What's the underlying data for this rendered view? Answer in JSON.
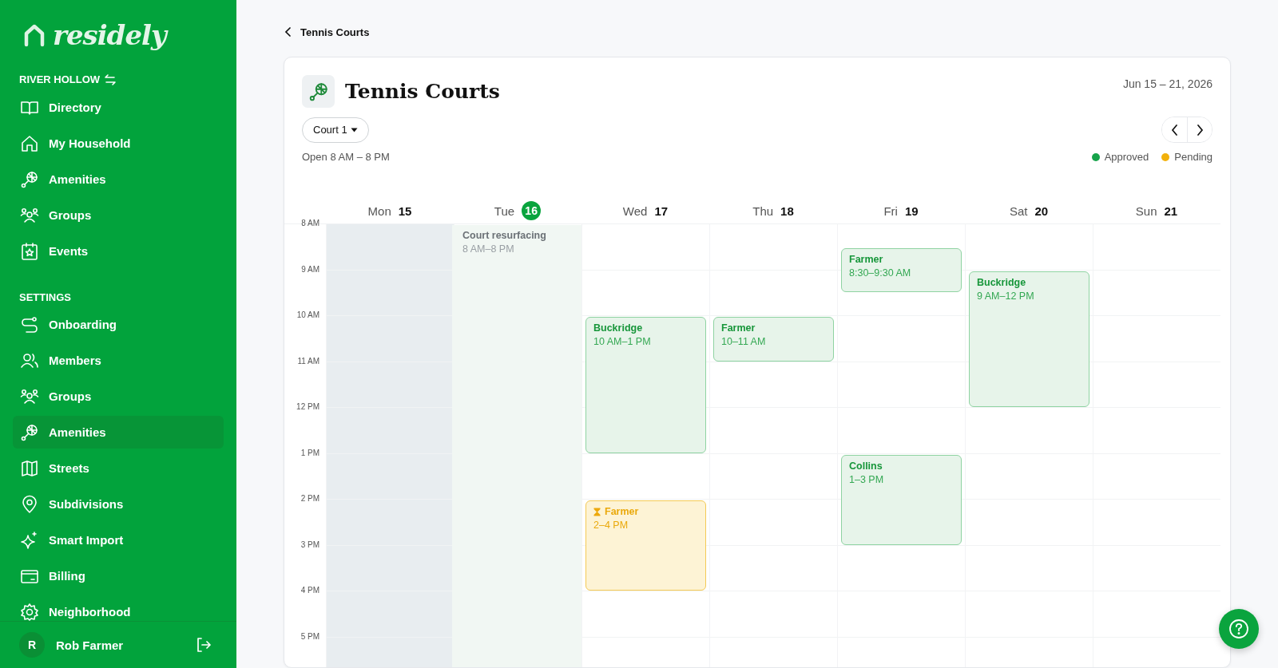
{
  "sidebar": {
    "logo": "residely",
    "community": "RIVER HOLLOW",
    "main_items": [
      {
        "label": "Directory",
        "selected": false
      },
      {
        "label": "My Household",
        "selected": false
      },
      {
        "label": "Amenities",
        "selected": false
      },
      {
        "label": "Groups",
        "selected": false
      },
      {
        "label": "Events",
        "selected": false
      }
    ],
    "settings_heading": "SETTINGS",
    "settings_items": [
      {
        "label": "Onboarding",
        "selected": false
      },
      {
        "label": "Members",
        "selected": false
      },
      {
        "label": "Groups",
        "selected": false
      },
      {
        "label": "Amenities",
        "selected": true
      },
      {
        "label": "Streets",
        "selected": false
      },
      {
        "label": "Subdivisions",
        "selected": false
      },
      {
        "label": "Smart Import",
        "selected": false
      },
      {
        "label": "Billing",
        "selected": false
      },
      {
        "label": "Neighborhood",
        "selected": false
      }
    ],
    "user": {
      "initial": "R",
      "name": "Rob Farmer"
    }
  },
  "back_link": "Tennis Courts",
  "header": {
    "title": "Tennis Courts",
    "date_range": "Jun 15 – 21, 2026",
    "court_select": "Court 1",
    "hours": "Open 8 AM – 8 PM",
    "legend": [
      {
        "label": "Approved",
        "color": "#16a34a"
      },
      {
        "label": "Pending",
        "color": "#f2b10c"
      }
    ]
  },
  "calendar": {
    "times": [
      "8 AM",
      "9 AM",
      "10 AM",
      "11 AM",
      "12 PM",
      "1 PM",
      "2 PM",
      "3 PM",
      "4 PM",
      "5 PM"
    ],
    "days": [
      {
        "name": "Mon",
        "date": "15",
        "today": false
      },
      {
        "name": "Tue",
        "date": "16",
        "today": true,
        "events": [
          {
            "title": "Court resurfacing",
            "time": "8 AM–8 PM",
            "kind": "closed"
          }
        ]
      },
      {
        "name": "Wed",
        "date": "17",
        "today": false,
        "events": [
          {
            "title": "Buckridge",
            "time": "10 AM–1 PM",
            "kind": "approved"
          },
          {
            "title": "Farmer",
            "time": "2–4 PM",
            "kind": "pending"
          }
        ]
      },
      {
        "name": "Thu",
        "date": "18",
        "today": false,
        "events": [
          {
            "title": "Farmer",
            "time": "10–11 AM",
            "kind": "approved"
          }
        ]
      },
      {
        "name": "Fri",
        "date": "19",
        "today": false,
        "events": [
          {
            "title": "Farmer",
            "time": "8:30–9:30 AM",
            "kind": "approved"
          },
          {
            "title": "Collins",
            "time": "1–3 PM",
            "kind": "approved"
          }
        ]
      },
      {
        "name": "Sat",
        "date": "20",
        "today": false,
        "events": [
          {
            "title": "Buckridge",
            "time": "9 AM–12 PM",
            "kind": "approved"
          }
        ]
      },
      {
        "name": "Sun",
        "date": "21",
        "today": false
      }
    ]
  }
}
